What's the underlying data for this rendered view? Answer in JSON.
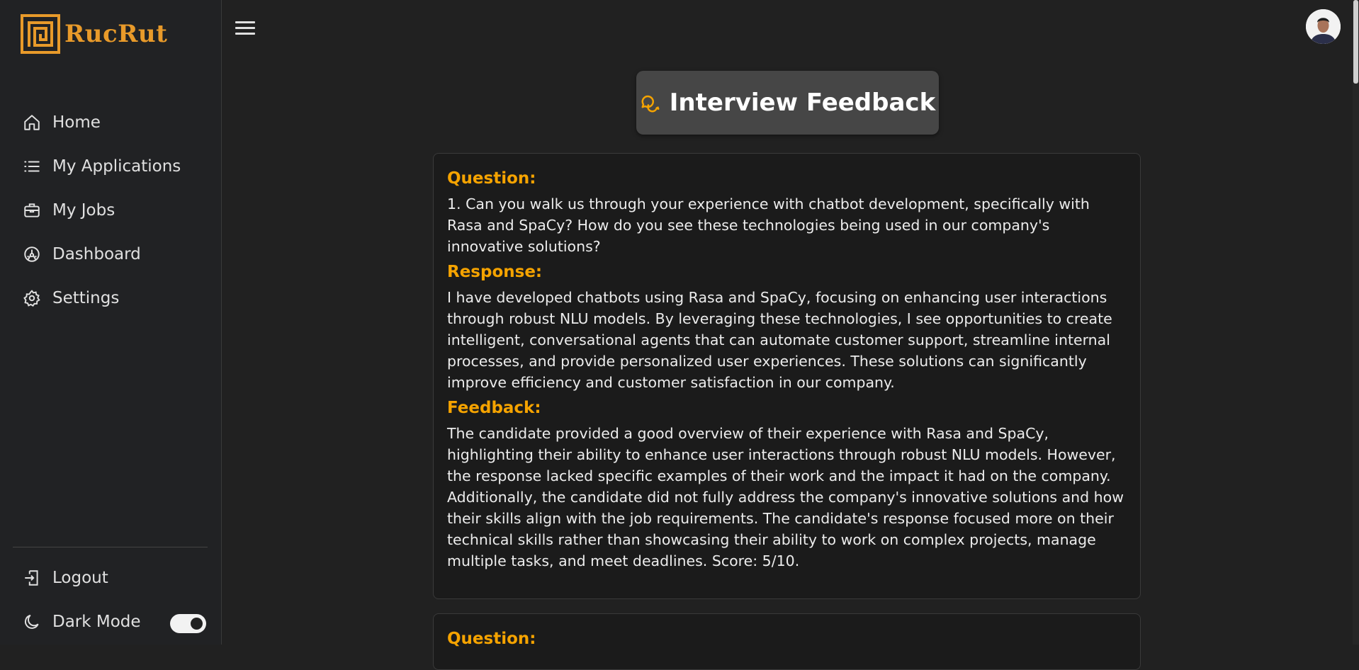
{
  "brand": {
    "name": "RucRut",
    "color": "#e89a2a"
  },
  "sidebar": {
    "items": [
      {
        "label": "Home",
        "icon": "home-icon"
      },
      {
        "label": "My Applications",
        "icon": "list-icon"
      },
      {
        "label": "My Jobs",
        "icon": "briefcase-icon"
      },
      {
        "label": "Dashboard",
        "icon": "dashboard-icon"
      },
      {
        "label": "Settings",
        "icon": "gear-icon"
      }
    ],
    "logout_label": "Logout",
    "dark_mode_label": "Dark Mode",
    "dark_mode_on": true
  },
  "header": {
    "menu_icon": "hamburger-icon",
    "avatar": "user-avatar"
  },
  "main": {
    "title": "Interview Feedback",
    "title_icon": "chat-bubbles-icon",
    "accent": "#f5a300",
    "items": [
      {
        "question_label": "Question:",
        "question": "1. Can you walk us through your experience with chatbot development, specifically with Rasa and SpaCy? How do you see these technologies being used in our company's innovative solutions?",
        "response_label": "Response:",
        "response": "I have developed chatbots using Rasa and SpaCy, focusing on enhancing user interactions through robust NLU models. By leveraging these technologies, I see opportunities to create intelligent, conversational agents that can automate customer support, streamline internal processes, and provide personalized user experiences. These solutions can significantly improve efficiency and customer satisfaction in our company.",
        "feedback_label": "Feedback:",
        "feedback": "The candidate provided a good overview of their experience with Rasa and SpaCy, highlighting their ability to enhance user interactions through robust NLU models. However, the response lacked specific examples of their work and the impact it had on the company. Additionally, the candidate did not fully address the company's innovative solutions and how their skills align with the job requirements. The candidate's response focused more on their technical skills rather than showcasing their ability to work on complex projects, manage multiple tasks, and meet deadlines. Score: 5/10."
      },
      {
        "question_label": "Question:"
      }
    ]
  }
}
